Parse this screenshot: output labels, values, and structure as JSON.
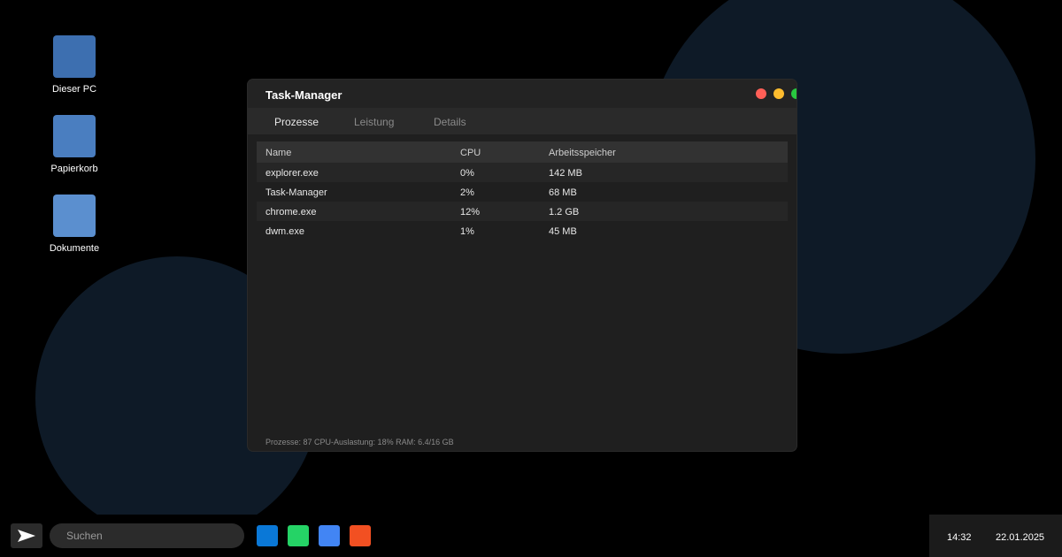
{
  "colors": {
    "desktop_bg": "#000000",
    "blob": "#0e1a27",
    "window_bg": "#1f1f1f",
    "close": "#ff5f57",
    "minimize": "#febc2e",
    "maximize": "#28c840"
  },
  "desktop": {
    "icons": [
      {
        "label": "Dieser PC",
        "color": "#3d6fb0"
      },
      {
        "label": "Papierkorb",
        "color": "#4a7ec0"
      },
      {
        "label": "Dokumente",
        "color": "#5b8fcf"
      }
    ]
  },
  "window": {
    "title": "Task-Manager",
    "tabs": [
      "Prozesse",
      "Leistung",
      "Details"
    ],
    "active_tab": "Prozesse",
    "table": {
      "columns": [
        "Name",
        "CPU",
        "Arbeitsspeicher"
      ],
      "rows": [
        [
          "explorer.exe",
          "0%",
          "142 MB"
        ],
        [
          "Task-Manager",
          "2%",
          "68 MB"
        ],
        [
          "chrome.exe",
          "12%",
          "1.2 GB"
        ],
        [
          "dwm.exe",
          "1%",
          "45 MB"
        ]
      ]
    },
    "status": "Prozesse: 87 CPU-Auslastung: 18% RAM: 6.4/16 GB"
  },
  "taskbar": {
    "search_placeholder": "Suchen",
    "apps": [
      {
        "icon": "blue-app-icon",
        "color": "#0a78d7"
      },
      {
        "icon": "green-app-icon",
        "color": "#25d366"
      },
      {
        "icon": "light-blue-app-icon",
        "color": "#4285f4"
      },
      {
        "icon": "orange-app-icon",
        "color": "#f25022"
      }
    ],
    "time": "14:32",
    "date": "22.01.2025"
  }
}
